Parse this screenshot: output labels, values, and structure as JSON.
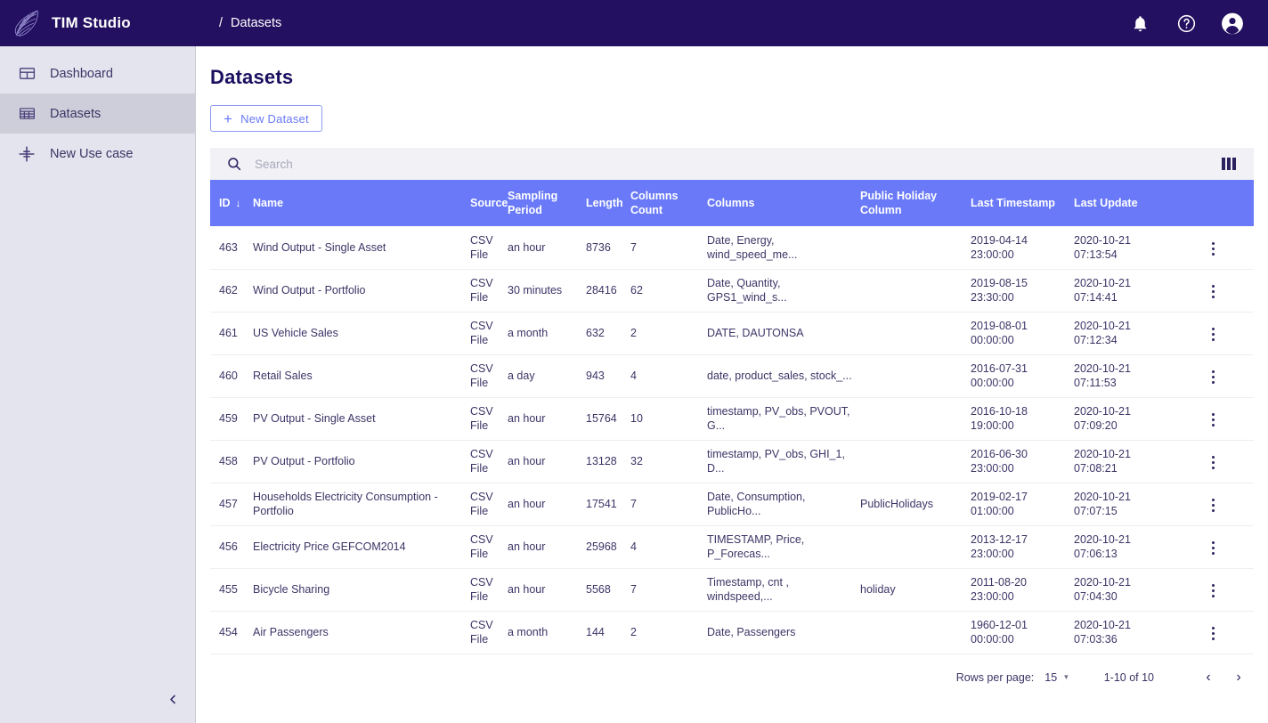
{
  "app": {
    "brand": "TIM Studio",
    "logo_icon": "mesh-net-logo"
  },
  "breadcrumb": {
    "separator": "/",
    "current": "Datasets"
  },
  "topbar_actions": [
    {
      "name": "notifications-icon",
      "label": "Notifications"
    },
    {
      "name": "help-icon",
      "label": "Help"
    },
    {
      "name": "account-icon",
      "label": "Account"
    }
  ],
  "sidebar": {
    "items": [
      {
        "label": "Dashboard",
        "icon": "dashboard-icon",
        "active": false
      },
      {
        "label": "Datasets",
        "icon": "table-icon",
        "active": true
      },
      {
        "label": "New Use case",
        "icon": "plus-cross-icon",
        "active": false
      }
    ],
    "collapse_icon": "chevron-left-icon"
  },
  "main": {
    "title": "Datasets",
    "new_dataset_button": "New Dataset",
    "new_dataset_plus": "+",
    "search": {
      "placeholder": "Search",
      "value": "",
      "icon": "search-icon"
    },
    "columns_toggle_icon": "view-columns-icon"
  },
  "table": {
    "headers": {
      "id": "ID",
      "name": "Name",
      "source": "Source",
      "sampling_period": "Sampling Period",
      "length": "Length",
      "columns_count": "Columns Count",
      "columns": "Columns",
      "public_holiday_column": "Public Holiday Column",
      "last_timestamp": "Last Timestamp",
      "last_update": "Last Update"
    },
    "sort_column": "ID",
    "sort_arrow": "↓",
    "rows": [
      {
        "id": "463",
        "name": "Wind Output - Single Asset",
        "source_line1": "CSV",
        "source_line2": "File",
        "sampling_period": "an hour",
        "length": "8736",
        "columns_count": "7",
        "columns_line1": "Date, Energy,",
        "columns_line2": "wind_speed_me...",
        "public_holiday_column": "",
        "last_timestamp_date": "2019-04-14",
        "last_timestamp_time": "23:00:00",
        "last_update_date": "2020-10-21",
        "last_update_time": "07:13:54"
      },
      {
        "id": "462",
        "name": "Wind Output - Portfolio",
        "source_line1": "CSV",
        "source_line2": "File",
        "sampling_period": "30 minutes",
        "length": "28416",
        "columns_count": "62",
        "columns_line1": "Date, Quantity, GPS1_wind_s...",
        "columns_line2": "",
        "public_holiday_column": "",
        "last_timestamp_date": "2019-08-15",
        "last_timestamp_time": "23:30:00",
        "last_update_date": "2020-10-21",
        "last_update_time": "07:14:41"
      },
      {
        "id": "461",
        "name": "US Vehicle Sales",
        "source_line1": "CSV",
        "source_line2": "File",
        "sampling_period": "a month",
        "length": "632",
        "columns_count": "2",
        "columns_line1": "DATE, DAUTONSA",
        "columns_line2": "",
        "public_holiday_column": "",
        "last_timestamp_date": "2019-08-01",
        "last_timestamp_time": "00:00:00",
        "last_update_date": "2020-10-21",
        "last_update_time": "07:12:34"
      },
      {
        "id": "460",
        "name": "Retail Sales",
        "source_line1": "CSV",
        "source_line2": "File",
        "sampling_period": "a day",
        "length": "943",
        "columns_count": "4",
        "columns_line1": "date, product_sales, stock_...",
        "columns_line2": "",
        "public_holiday_column": "",
        "last_timestamp_date": "2016-07-31",
        "last_timestamp_time": "00:00:00",
        "last_update_date": "2020-10-21",
        "last_update_time": "07:11:53"
      },
      {
        "id": "459",
        "name": "PV Output - Single Asset",
        "source_line1": "CSV",
        "source_line2": "File",
        "sampling_period": "an hour",
        "length": "15764",
        "columns_count": "10",
        "columns_line1": "timestamp, PV_obs, PVOUT,",
        "columns_line2": "G...",
        "public_holiday_column": "",
        "last_timestamp_date": "2016-10-18",
        "last_timestamp_time": "19:00:00",
        "last_update_date": "2020-10-21",
        "last_update_time": "07:09:20"
      },
      {
        "id": "458",
        "name": "PV Output - Portfolio",
        "source_line1": "CSV",
        "source_line2": "File",
        "sampling_period": "an hour",
        "length": "13128",
        "columns_count": "32",
        "columns_line1": "timestamp, PV_obs, GHI_1, D...",
        "columns_line2": "",
        "public_holiday_column": "",
        "last_timestamp_date": "2016-06-30",
        "last_timestamp_time": "23:00:00",
        "last_update_date": "2020-10-21",
        "last_update_time": "07:08:21"
      },
      {
        "id": "457",
        "name": "Households Electricity Consumption - Portfolio",
        "source_line1": "CSV",
        "source_line2": "File",
        "sampling_period": "an hour",
        "length": "17541",
        "columns_count": "7",
        "columns_line1": "Date, Consumption,",
        "columns_line2": "PublicHo...",
        "public_holiday_column": "PublicHolidays",
        "last_timestamp_date": "2019-02-17",
        "last_timestamp_time": "01:00:00",
        "last_update_date": "2020-10-21",
        "last_update_time": "07:07:15"
      },
      {
        "id": "456",
        "name": "Electricity Price GEFCOM2014",
        "source_line1": "CSV",
        "source_line2": "File",
        "sampling_period": "an hour",
        "length": "25968",
        "columns_count": "4",
        "columns_line1": "TIMESTAMP, Price,",
        "columns_line2": "P_Forecas...",
        "public_holiday_column": "",
        "last_timestamp_date": "2013-12-17",
        "last_timestamp_time": "23:00:00",
        "last_update_date": "2020-10-21",
        "last_update_time": "07:06:13"
      },
      {
        "id": "455",
        "name": "Bicycle Sharing",
        "source_line1": "CSV",
        "source_line2": "File",
        "sampling_period": "an hour",
        "length": "5568",
        "columns_count": "7",
        "columns_line1": "Timestamp, cnt , windspeed,...",
        "columns_line2": "",
        "public_holiday_column": "holiday",
        "last_timestamp_date": "2011-08-20",
        "last_timestamp_time": "23:00:00",
        "last_update_date": "2020-10-21",
        "last_update_time": "07:04:30"
      },
      {
        "id": "454",
        "name": "Air Passengers",
        "source_line1": "CSV",
        "source_line2": "File",
        "sampling_period": "a month",
        "length": "144",
        "columns_count": "2",
        "columns_line1": "Date, Passengers",
        "columns_line2": "",
        "public_holiday_column": "",
        "last_timestamp_date": "1960-12-01",
        "last_timestamp_time": "00:00:00",
        "last_update_date": "2020-10-21",
        "last_update_time": "07:03:36"
      }
    ]
  },
  "pagination": {
    "rows_per_page_label": "Rows per page:",
    "rows_per_page_value": "15",
    "caret": "▾",
    "range": "1-10 of 10",
    "prev": "‹",
    "next": "›"
  },
  "colors": {
    "topbar": "#231060",
    "accent_blue": "#6979f8",
    "sidebar_bg": "#e3e4ee",
    "sidebar_active": "#cdced9",
    "text_dark": "#3b3566"
  }
}
